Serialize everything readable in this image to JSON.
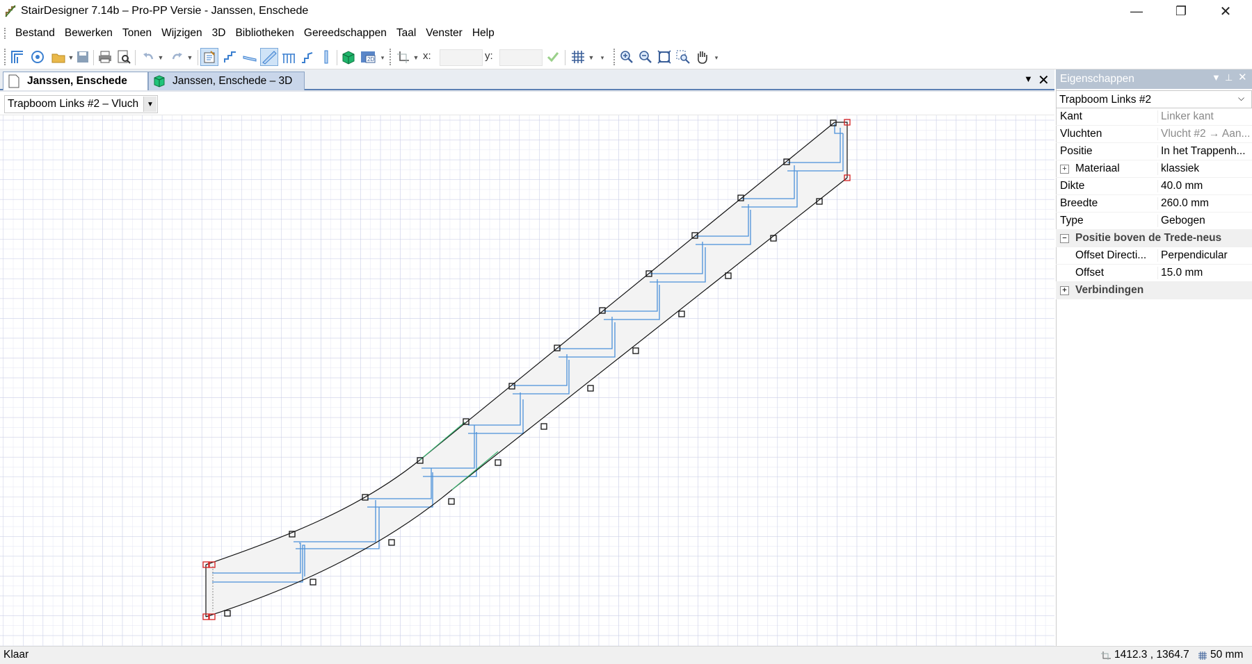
{
  "window": {
    "title": "StairDesigner 7.14b – Pro-PP Versie - Janssen,  Enschede",
    "minimize": "—",
    "maximize": "❐",
    "close": "✕"
  },
  "menu": [
    "Bestand",
    "Bewerken",
    "Tonen",
    "Wijzigen",
    "3D",
    "Bibliotheken",
    "Gereedschappen",
    "Taal",
    "Venster",
    "Help"
  ],
  "toolbar": {
    "x_label": "x:",
    "y_label": "y:",
    "x_value": "",
    "y_value": ""
  },
  "tabs": [
    {
      "label": "Janssen,  Enschede",
      "icon": "document-icon",
      "active": true
    },
    {
      "label": "Janssen,  Enschede – 3D",
      "icon": "cube-3d-icon",
      "active": false
    }
  ],
  "selector": {
    "value": "Trapboom Links #2 – Vluch"
  },
  "properties": {
    "header": "Eigenschappen",
    "object": "Trapboom Links #2",
    "rows": [
      {
        "name": "Kant",
        "value": "Linker kant",
        "type": "readonly"
      },
      {
        "name": "Vluchten",
        "value": "Vlucht #2 → Aan...",
        "type": "readonly"
      },
      {
        "name": "Positie",
        "value": "In het Trappenh...",
        "type": "value"
      },
      {
        "name": "Materiaal",
        "value": "klassiek",
        "type": "expandable"
      },
      {
        "name": "Dikte",
        "value": "40.0 mm",
        "type": "value"
      },
      {
        "name": "Breedte",
        "value": "260.0 mm",
        "type": "value"
      },
      {
        "name": "Type",
        "value": "Gebogen",
        "type": "value"
      },
      {
        "name": "Positie boven de Trede-neus",
        "value": "",
        "type": "category-open"
      },
      {
        "name": "Offset Directi...",
        "value": "Perpendicular",
        "type": "child"
      },
      {
        "name": "Offset",
        "value": "15.0 mm",
        "type": "child"
      },
      {
        "name": "Verbindingen",
        "value": "",
        "type": "category-closed"
      }
    ]
  },
  "status": {
    "text": "Klaar",
    "coords": "1412.3 , 1364.7",
    "grid": "50 mm"
  },
  "colors": {
    "accent": "#5b7fb3",
    "step_lines": "#4a90d9",
    "stringer": "#000000",
    "handle_red": "#d62020",
    "grid": "#d6d9ef",
    "connector_green": "#3cb371"
  }
}
